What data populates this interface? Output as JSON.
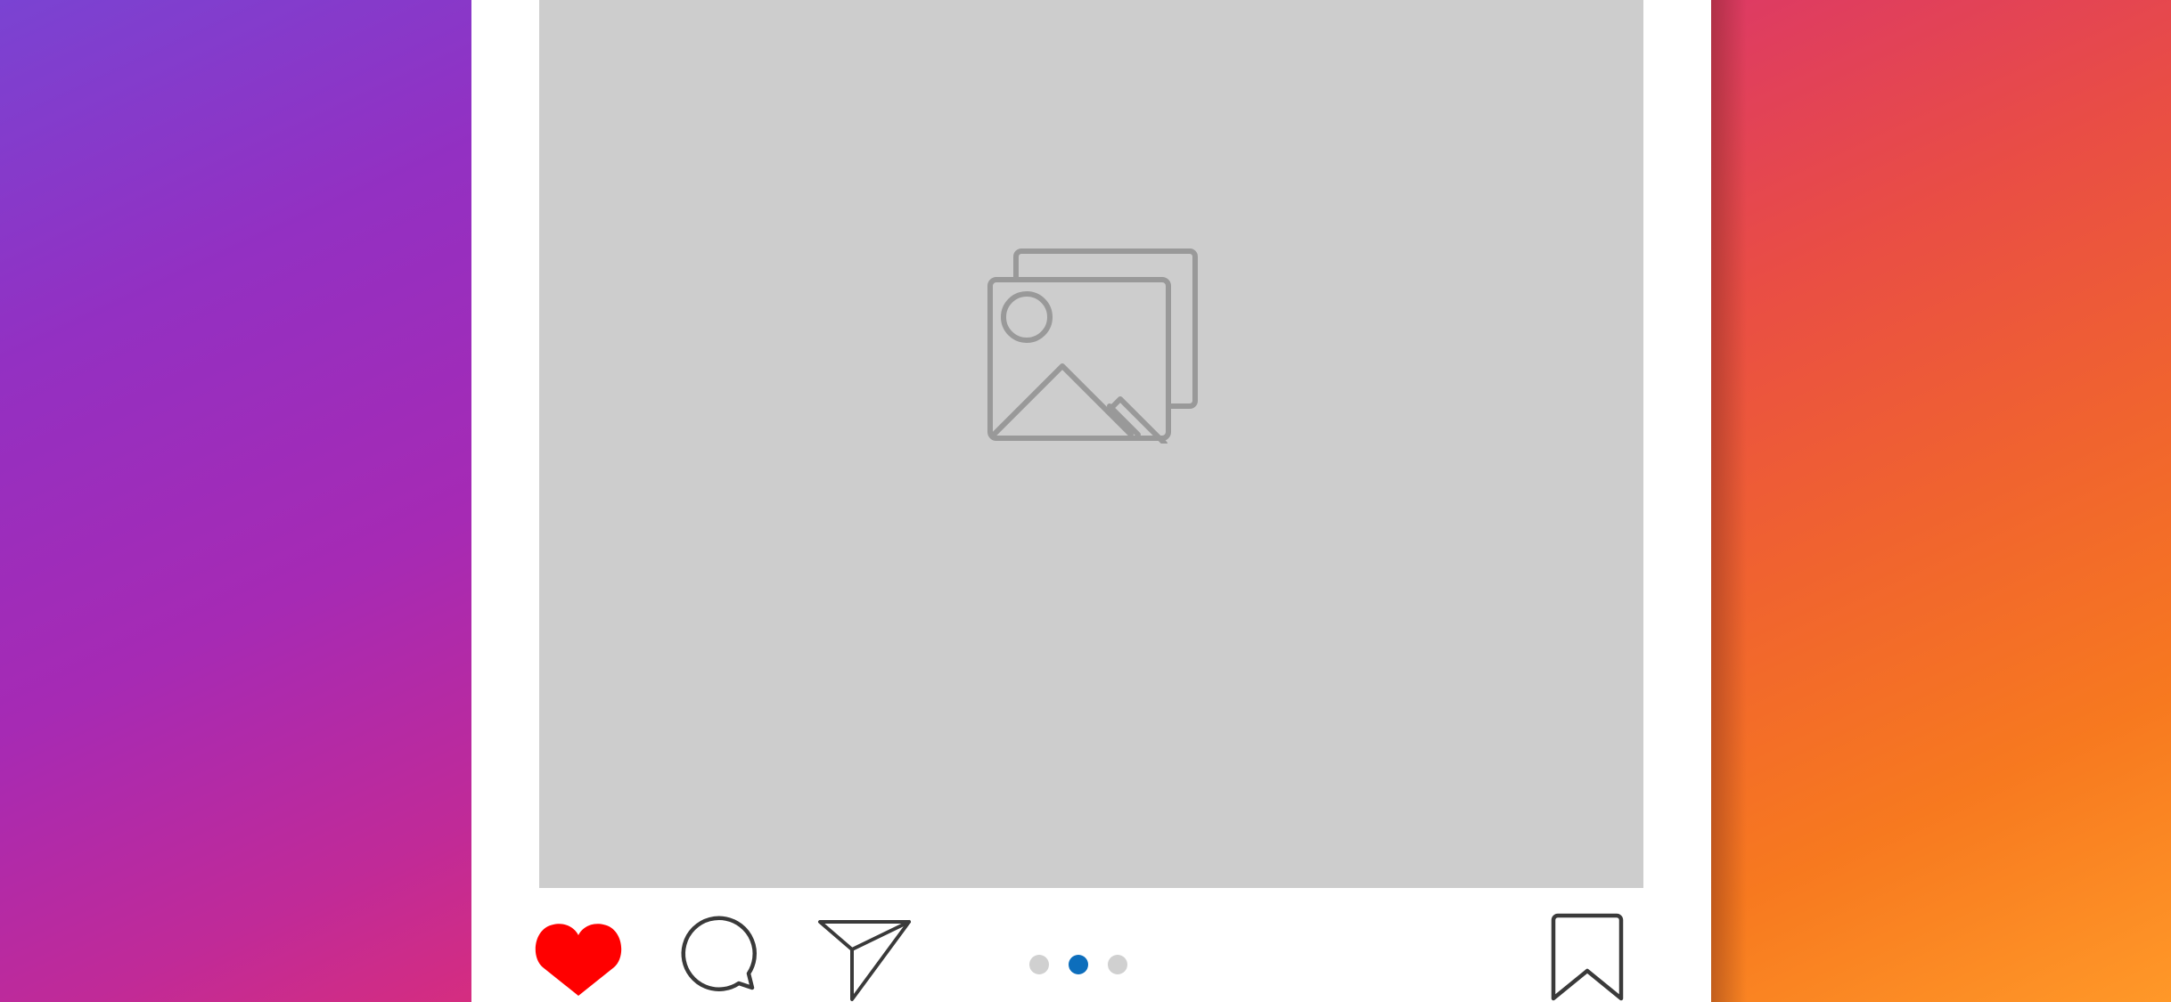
{
  "post": {
    "media": {
      "placeholder_icon": "image-gallery-icon",
      "background_color": "#cdcdcd"
    },
    "actions": {
      "like_icon": "heart-icon",
      "liked": true,
      "like_color": "#ff0000",
      "comment_icon": "comment-bubble-icon",
      "share_icon": "paper-plane-icon",
      "save_icon": "bookmark-icon"
    },
    "carousel": {
      "total_slides": 3,
      "active_slide": 2,
      "active_color": "#0d6ebc",
      "inactive_color": "#d0d0d0"
    }
  },
  "background": {
    "left_gradient": [
      "#7a43d2",
      "#d52d80"
    ],
    "right_gradient": [
      "#dd3a64",
      "#ff9828"
    ]
  }
}
